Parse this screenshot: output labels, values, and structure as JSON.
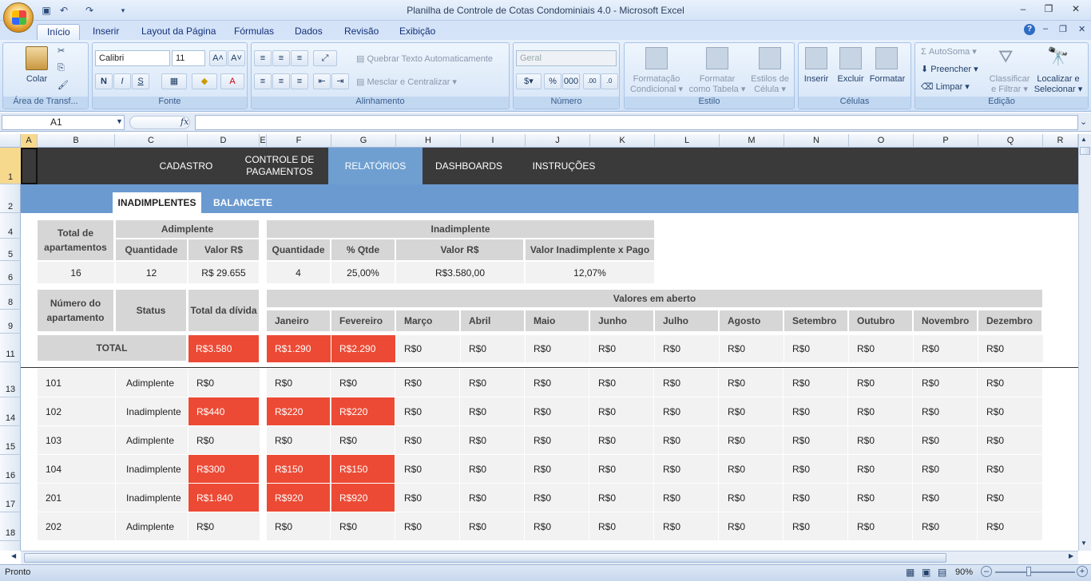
{
  "window": {
    "title": "Planilha de Controle de Cotas Condominiais 4.0  -  Microsoft Excel"
  },
  "ribbon_tabs": [
    "Início",
    "Inserir",
    "Layout da Página",
    "Fórmulas",
    "Dados",
    "Revisão",
    "Exibição"
  ],
  "ribbon": {
    "clipboard": {
      "paste": "Colar",
      "label": "Área de Transf..."
    },
    "font": {
      "name": "Calibri",
      "size": "11",
      "label": "Fonte",
      "bold": "N",
      "italic": "I",
      "underline": "S"
    },
    "alignment": {
      "wrap": "Quebrar Texto Automaticamente",
      "merge": "Mesclar e Centralizar",
      "label": "Alinhamento"
    },
    "number": {
      "format": "Geral",
      "percent": "%",
      "thousands": "000",
      "label": "Número"
    },
    "styles": {
      "cond1": "Formatação",
      "cond2": "Condicional",
      "table1": "Formatar",
      "table2": "como Tabela",
      "cell1": "Estilos de",
      "cell2": "Célula",
      "label": "Estilo"
    },
    "cells": {
      "insert": "Inserir",
      "delete": "Excluir",
      "format": "Formatar",
      "label": "Células"
    },
    "editing": {
      "autosum": "AutoSoma",
      "fill": "Preencher",
      "clear": "Limpar",
      "sort1": "Classificar",
      "sort2": "e Filtrar",
      "find1": "Localizar e",
      "find2": "Selecionar",
      "label": "Edição"
    }
  },
  "formula_bar": {
    "name_box": "A1",
    "fx": "fx",
    "value": ""
  },
  "columns": [
    "A",
    "B",
    "C",
    "D",
    "E",
    "F",
    "G",
    "H",
    "I",
    "J",
    "K",
    "L",
    "M",
    "N",
    "O",
    "P",
    "Q",
    "R"
  ],
  "row_numbers": [
    "1",
    "2",
    "4",
    "5",
    "6",
    "8",
    "9",
    "11",
    "13",
    "14",
    "15",
    "16",
    "17",
    "18"
  ],
  "nav": [
    "CADASTRO",
    "CONTROLE DE PAGAMENTOS",
    "RELATÓRIOS",
    "DASHBOARDS",
    "INSTRUÇÕES"
  ],
  "subtabs": [
    "INADIMPLENTES",
    "BALANCETE"
  ],
  "summary": {
    "total_apts_label": "Total de apartamentos",
    "adimplente_label": "Adimplente",
    "inadimplente_label": "Inadimplente",
    "quantidade": "Quantidade",
    "valor": "Valor R$",
    "pct_qtde": "% Qtde",
    "valor_inad_pago": "Valor Inadimplente x Pago",
    "total_apts": "16",
    "adim_qtd": "12",
    "adim_valor": "R$ 29.655",
    "inad_qtd": "4",
    "inad_pct": "25,00%",
    "inad_valor": "R$3.580,00",
    "inad_x_pago": "12,07%"
  },
  "detail": {
    "apt_label": "Número do apartamento",
    "status_label": "Status",
    "total_label": "Total da dívida",
    "open_label": "Valores em aberto",
    "months": [
      "Janeiro",
      "Fevereiro",
      "Março",
      "Abril",
      "Maio",
      "Junho",
      "Julho",
      "Agosto",
      "Setembro",
      "Outubro",
      "Novembro",
      "Dezembro"
    ],
    "total_row": {
      "label": "TOTAL",
      "total": "R$3.580",
      "months": [
        "R$1.290",
        "R$2.290",
        "R$0",
        "R$0",
        "R$0",
        "R$0",
        "R$0",
        "R$0",
        "R$0",
        "R$0",
        "R$0",
        "R$0"
      ]
    },
    "rows": [
      {
        "apt": "101",
        "status": "Adimplente",
        "total": "R$0",
        "months": [
          "R$0",
          "R$0",
          "R$0",
          "R$0",
          "R$0",
          "R$0",
          "R$0",
          "R$0",
          "R$0",
          "R$0",
          "R$0",
          "R$0"
        ]
      },
      {
        "apt": "102",
        "status": "Inadimplente",
        "total": "R$440",
        "months": [
          "R$220",
          "R$220",
          "R$0",
          "R$0",
          "R$0",
          "R$0",
          "R$0",
          "R$0",
          "R$0",
          "R$0",
          "R$0",
          "R$0"
        ]
      },
      {
        "apt": "103",
        "status": "Adimplente",
        "total": "R$0",
        "months": [
          "R$0",
          "R$0",
          "R$0",
          "R$0",
          "R$0",
          "R$0",
          "R$0",
          "R$0",
          "R$0",
          "R$0",
          "R$0",
          "R$0"
        ]
      },
      {
        "apt": "104",
        "status": "Inadimplente",
        "total": "R$300",
        "months": [
          "R$150",
          "R$150",
          "R$0",
          "R$0",
          "R$0",
          "R$0",
          "R$0",
          "R$0",
          "R$0",
          "R$0",
          "R$0",
          "R$0"
        ]
      },
      {
        "apt": "201",
        "status": "Inadimplente",
        "total": "R$1.840",
        "months": [
          "R$920",
          "R$920",
          "R$0",
          "R$0",
          "R$0",
          "R$0",
          "R$0",
          "R$0",
          "R$0",
          "R$0",
          "R$0",
          "R$0"
        ]
      },
      {
        "apt": "202",
        "status": "Adimplente",
        "total": "R$0",
        "months": [
          "R$0",
          "R$0",
          "R$0",
          "R$0",
          "R$0",
          "R$0",
          "R$0",
          "R$0",
          "R$0",
          "R$0",
          "R$0",
          "R$0"
        ]
      }
    ]
  },
  "status": {
    "ready": "Pronto",
    "zoom": "90%"
  },
  "colors": {
    "red": "#ec4a35",
    "nav": "#3a3a3a",
    "blue": "#6a9ad0"
  }
}
